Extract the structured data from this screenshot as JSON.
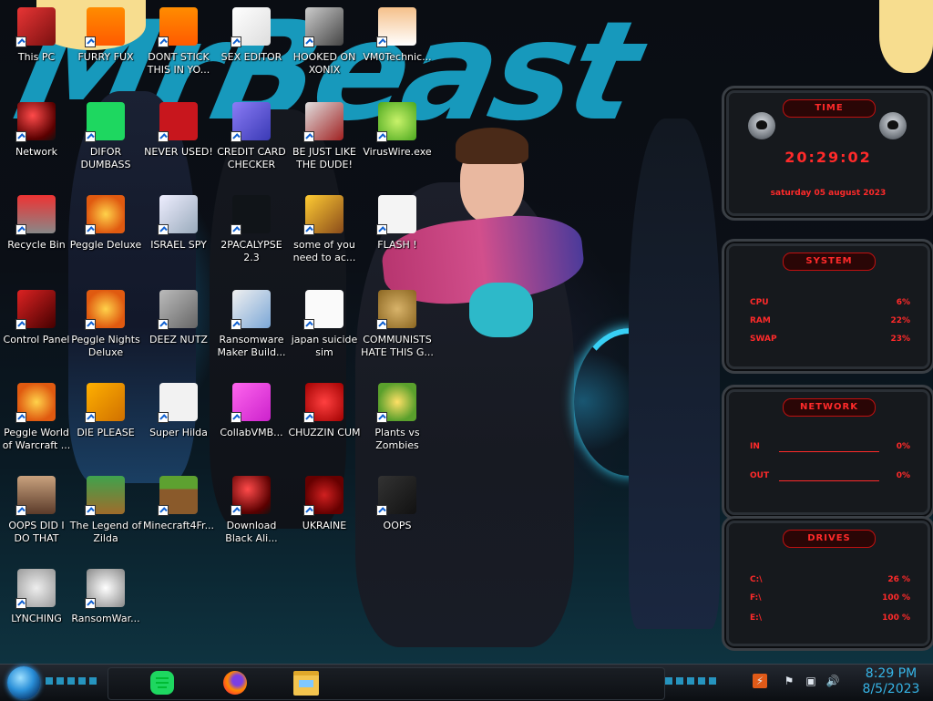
{
  "desktop_icons": [
    {
      "label": "This PC",
      "icon": "this-pc-icon"
    },
    {
      "label": "FURRY FUX",
      "icon": "vlc-cone-icon"
    },
    {
      "label": "DONT STICK THIS IN YO...",
      "icon": "vlc-cone-icon"
    },
    {
      "label": "SEX EDITOR",
      "icon": "hex-editor-icon"
    },
    {
      "label": "HOOKED ON XONIX",
      "icon": "xonix-game-icon"
    },
    {
      "label": "VM0Technic...",
      "icon": "doctor-person-icon"
    },
    {
      "label": "Network",
      "icon": "red-orb-icon"
    },
    {
      "label": "DIFOR DUMBASS",
      "icon": "chat-app-icon"
    },
    {
      "label": "NEVER USED!",
      "icon": "dev-cpp-icon"
    },
    {
      "label": "CREDIT CARD CHECKER",
      "icon": "credit-card-icon"
    },
    {
      "label": "BE JUST LIKE THE DUDE!",
      "icon": "santa-dude-icon"
    },
    {
      "label": "VirusWire.exe",
      "icon": "lime-icon"
    },
    {
      "label": "Recycle Bin",
      "icon": "recycle-bin-icon"
    },
    {
      "label": "Peggle Deluxe",
      "icon": "peggle-icon"
    },
    {
      "label": "ISRAEL SPY",
      "icon": "spy-drive-icon"
    },
    {
      "label": "2PACALYPSE 2.3",
      "icon": "console-icon"
    },
    {
      "label": "some of you need to ac...",
      "icon": "beaver-icon"
    },
    {
      "label": "FLASH !",
      "icon": "flash-document-icon"
    },
    {
      "label": "Control Panel",
      "icon": "control-panel-icon"
    },
    {
      "label": "Peggle Nights Deluxe",
      "icon": "peggle-icon"
    },
    {
      "label": "DEEZ NUTZ",
      "icon": "windows-stack-icon"
    },
    {
      "label": "Ransomware Maker Build...",
      "icon": "window-app-icon"
    },
    {
      "label": "japan suicide sim",
      "icon": "document-icon"
    },
    {
      "label": "COMMUNISTS HATE THIS G...",
      "icon": "money-bag-icon"
    },
    {
      "label": "Peggle World of Warcraft ...",
      "icon": "peggle-icon"
    },
    {
      "label": "DIE PLEASE",
      "icon": "die-app-icon"
    },
    {
      "label": "Super Hilda",
      "icon": "pixel-ghost-icon"
    },
    {
      "label": "CollabVMB...",
      "icon": "collabvm-icon"
    },
    {
      "label": "CHUZZIN CUM",
      "icon": "chuzzle-icon"
    },
    {
      "label": "Plants vs Zombies",
      "icon": "flower-icon"
    },
    {
      "label": "OOPS DID I DO THAT",
      "icon": "portrait-icon"
    },
    {
      "label": "The Legend of Zilda",
      "icon": "zelda-character-icon"
    },
    {
      "label": "Minecraft4Fr...",
      "icon": "minecraft-block-icon"
    },
    {
      "label": "Download Black Ali...",
      "icon": "red-orb-icon"
    },
    {
      "label": "UKRAINE",
      "icon": "radiation-icon"
    },
    {
      "label": "OOPS",
      "icon": "monitor-icon"
    },
    {
      "label": "LYNCHING",
      "icon": "rope-icon"
    },
    {
      "label": "RansomWar...",
      "icon": "skull-icon"
    }
  ],
  "widget": {
    "time": {
      "title": "TIME",
      "clock": "20:29:02",
      "date": "saturday 05 august 2023"
    },
    "system": {
      "title": "SYSTEM",
      "rows": [
        {
          "label": "CPU",
          "value": "6%"
        },
        {
          "label": "RAM",
          "value": "22%"
        },
        {
          "label": "SWAP",
          "value": "23%"
        }
      ]
    },
    "network": {
      "title": "NETWORK",
      "rows": [
        {
          "label": "IN",
          "value": "0%"
        },
        {
          "label": "OUT",
          "value": "0%"
        }
      ]
    },
    "drives": {
      "title": "DRIVES",
      "rows": [
        {
          "label": "C:\\",
          "value": "26 %"
        },
        {
          "label": "F:\\",
          "value": "100 %"
        },
        {
          "label": "E:\\",
          "value": "100 %"
        }
      ]
    }
  },
  "wallpaper": {
    "text": "MrBeast"
  },
  "taskbar": {
    "start": "start-orb-icon",
    "pinned": [
      "chat-app-icon",
      "firefox-icon",
      "file-explorer-icon"
    ],
    "tray": [
      "firefox-tray-icon",
      "flag-icon",
      "network-icon",
      "volume-icon"
    ],
    "time": "8:29 PM",
    "date": "8/5/2023"
  },
  "colors": {
    "accent": "#36b4e6",
    "widget_red": "#ff2a2a"
  }
}
